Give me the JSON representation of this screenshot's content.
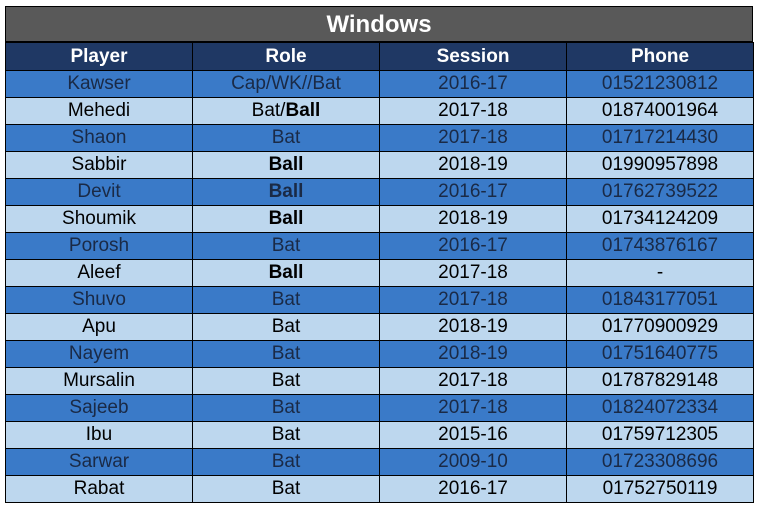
{
  "title": "Windows",
  "columns": [
    "Player",
    "Role",
    "Session",
    "Phone"
  ],
  "rows": [
    {
      "player": "Kawser",
      "role": [
        {
          "t": "Cap/WK//Bat",
          "b": false
        }
      ],
      "session": "2016-17",
      "phone": "01521230812"
    },
    {
      "player": "Mehedi",
      "role": [
        {
          "t": "Bat/",
          "b": false
        },
        {
          "t": "Ball",
          "b": true
        }
      ],
      "session": "2017-18",
      "phone": "01874001964"
    },
    {
      "player": "Shaon",
      "role": [
        {
          "t": "Bat",
          "b": false
        }
      ],
      "session": "2017-18",
      "phone": "01717214430"
    },
    {
      "player": "Sabbir",
      "role": [
        {
          "t": "Ball",
          "b": true
        }
      ],
      "session": "2018-19",
      "phone": "01990957898"
    },
    {
      "player": "Devit",
      "role": [
        {
          "t": "Ball",
          "b": true
        }
      ],
      "session": "2016-17",
      "phone": "01762739522"
    },
    {
      "player": "Shoumik",
      "role": [
        {
          "t": "Ball",
          "b": true
        }
      ],
      "session": "2018-19",
      "phone": "01734124209"
    },
    {
      "player": "Porosh",
      "role": [
        {
          "t": "Bat",
          "b": false
        }
      ],
      "session": "2016-17",
      "phone": "01743876167"
    },
    {
      "player": "Aleef",
      "role": [
        {
          "t": "Ball",
          "b": true
        }
      ],
      "session": "2017-18",
      "phone": "-"
    },
    {
      "player": "Shuvo",
      "role": [
        {
          "t": "Bat",
          "b": false
        }
      ],
      "session": "2017-18",
      "phone": "01843177051"
    },
    {
      "player": "Apu",
      "role": [
        {
          "t": "Bat",
          "b": false
        }
      ],
      "session": "2018-19",
      "phone": "01770900929"
    },
    {
      "player": "Nayem",
      "role": [
        {
          "t": "Bat",
          "b": false
        }
      ],
      "session": "2018-19",
      "phone": "01751640775"
    },
    {
      "player": "Mursalin",
      "role": [
        {
          "t": "Bat",
          "b": false
        }
      ],
      "session": "2017-18",
      "phone": "01787829148"
    },
    {
      "player": "Sajeeb",
      "role": [
        {
          "t": "Bat",
          "b": false
        }
      ],
      "session": "2017-18",
      "phone": "01824072334"
    },
    {
      "player": "Ibu",
      "role": [
        {
          "t": "Bat",
          "b": false
        }
      ],
      "session": "2015-16",
      "phone": "01759712305"
    },
    {
      "player": "Sarwar",
      "role": [
        {
          "t": "Bat",
          "b": false
        }
      ],
      "session": "2009-10",
      "phone": "01723308696"
    },
    {
      "player": "Rabat",
      "role": [
        {
          "t": "Bat",
          "b": false
        }
      ],
      "session": "2016-17",
      "phone": "01752750119"
    }
  ],
  "colors": {
    "title_bg": "#595959",
    "header_bg": "#1f3864",
    "row_dark": "#3a7ac8",
    "row_light": "#bdd7ee"
  }
}
